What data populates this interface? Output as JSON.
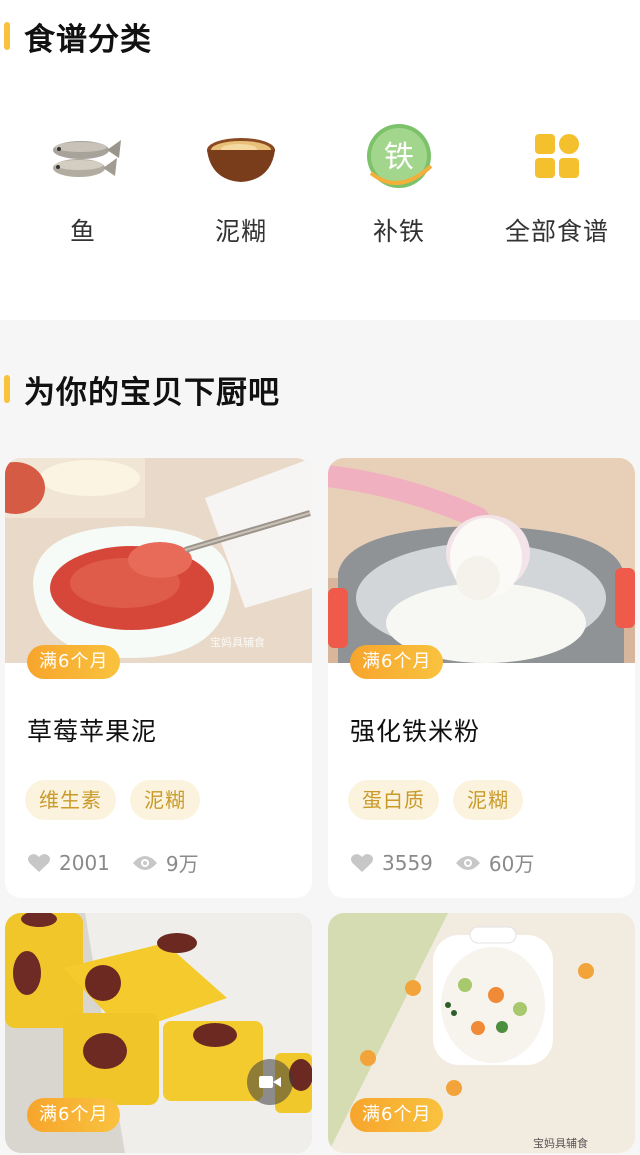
{
  "categories_section": {
    "title": "食谱分类",
    "items": [
      {
        "label": "鱼",
        "icon": "fish-icon"
      },
      {
        "label": "泥糊",
        "icon": "bowl-icon"
      },
      {
        "label": "补铁",
        "icon": "iron-badge-icon",
        "icon_text": "铁"
      },
      {
        "label": "全部食谱",
        "icon": "grid-icon"
      }
    ]
  },
  "recipes_section": {
    "title": "为你的宝贝下厨吧",
    "cards": [
      {
        "age": "满6个月",
        "title": "草莓苹果泥",
        "tags": [
          "维生素",
          "泥糊"
        ],
        "likes": "2001",
        "views": "9万"
      },
      {
        "age": "满6个月",
        "title": "强化铁米粉",
        "tags": [
          "蛋白质",
          "泥糊"
        ],
        "likes": "3559",
        "views": "60万"
      },
      {
        "age": "满6个月"
      },
      {
        "age": "满6个月"
      }
    ]
  },
  "colors": {
    "accent": "#f7c33c",
    "badge": "#f7a52c",
    "tag_bg": "#fbf3dd",
    "tag_text": "#c99a2a"
  }
}
